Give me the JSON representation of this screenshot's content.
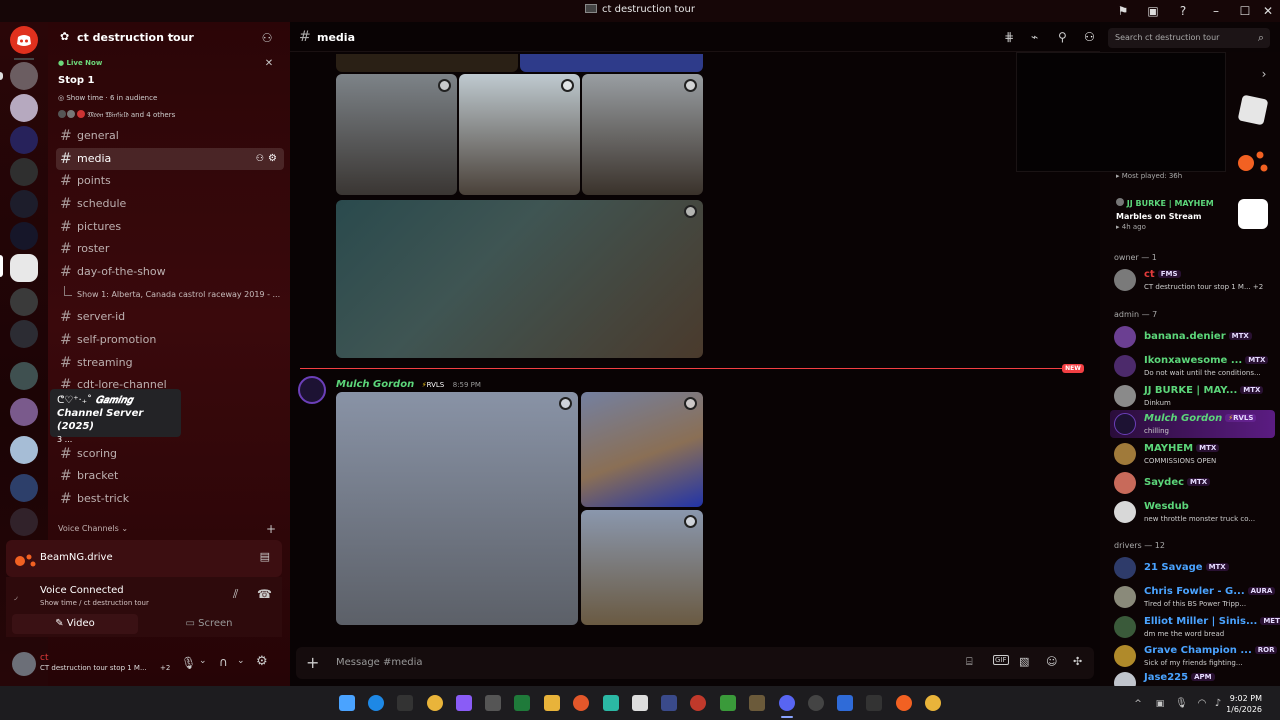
{
  "window": {
    "title": "ct destruction tour"
  },
  "server": {
    "name": "ct destruction tour",
    "live": {
      "badge": "Live Now",
      "title": "Stop 1",
      "meta": "Show time · 6 in audience",
      "participants": "𝔐𝔬𝔬𝔫 𝔚𝔦𝔫𝔣𝔦𝔢𝔩𝔡  and 4 others"
    },
    "channels": [
      {
        "name": "general"
      },
      {
        "name": "media"
      },
      {
        "name": "points"
      },
      {
        "name": "schedule"
      },
      {
        "name": "pictures"
      },
      {
        "name": "roster"
      },
      {
        "name": "day-of-the-show"
      },
      {
        "name": "server-id"
      },
      {
        "name": "self-promotion"
      },
      {
        "name": "streaming"
      },
      {
        "name": "cdt-lore-channel"
      },
      {
        "name": "scoring"
      },
      {
        "name": "bracket"
      },
      {
        "name": "best-trick"
      }
    ],
    "thread": "Show 1: Alberta, Canada castrol raceway 2019 - ...",
    "voice_header": "Voice Channels",
    "tooltip": {
      "line1": "𝑮𝒂𝒎𝒊𝒏𝒈",
      "line2": "Channel Server (2025)",
      "line3": "3 ..."
    }
  },
  "activity": {
    "game": "BeamNG.drive"
  },
  "voice": {
    "status": "Voice Connected",
    "channel": "Show time / ct destruction tour",
    "video_label": "Video",
    "screen_label": "Screen"
  },
  "user": {
    "name": "ct",
    "status": "CT destruction tour stop 1 M...",
    "extra": "+2"
  },
  "chat": {
    "channel": "media",
    "search_placeholder": "Search ct destruction tour",
    "new_badge": "NEW",
    "message": {
      "author": "Mulch Gordon",
      "tag": "RVLS",
      "time": "8:59 PM"
    },
    "composer_placeholder": "Message #media"
  },
  "members": {
    "top_activity": {
      "text": "Most played: 36h",
      "user": "JJ BURKE | MAYHEM",
      "game": "Marbles on Stream",
      "ago": "4h ago"
    },
    "groups": [
      {
        "header": "owner — 1",
        "members": [
          {
            "name": "ct",
            "tag": "FMS",
            "sub": "CT destruction tour stop 1 M... +2",
            "color": "#e23b3b"
          }
        ]
      },
      {
        "header": "admin — 7",
        "members": [
          {
            "name": "banana.denier",
            "tag": "MTX",
            "sub": "",
            "color": "#5cd67a"
          },
          {
            "name": "Ikonxawesome ...",
            "tag": "MTX",
            "sub": "Do not wait until the conditions...",
            "color": "#5cd67a"
          },
          {
            "name": "JJ BURKE | MAY...",
            "tag": "MTX",
            "sub": "Dinkum",
            "color": "#5cd67a"
          },
          {
            "name": "Mulch Gordon",
            "tag": "RVLS",
            "sub": "chilling",
            "color": "#5cd67a"
          },
          {
            "name": "MAYHEM",
            "tag": "MTX",
            "sub": "COMMISSIONS OPEN",
            "color": "#5cd67a"
          },
          {
            "name": "Saydec",
            "tag": "MTX",
            "sub": "",
            "color": "#5cd67a"
          },
          {
            "name": "Wesdub",
            "tag": "",
            "sub": "new throttle monster truck co...",
            "color": "#5cd67a"
          }
        ]
      },
      {
        "header": "drivers — 12",
        "members": [
          {
            "name": "21 Savage",
            "tag": "MTX",
            "sub": "",
            "color": "#4aa3ff"
          },
          {
            "name": "Chris Fowler - G...",
            "tag": "AURA",
            "sub": "Tired of this BS Power Tripp...",
            "color": "#4aa3ff"
          },
          {
            "name": "Elliot Miller | Sinis...",
            "tag": "MET",
            "sub": "dm me the word bread",
            "color": "#4aa3ff"
          },
          {
            "name": "Grave Champion ...",
            "tag": "ROR",
            "sub": "Sick of my friends fighting...",
            "color": "#4aa3ff"
          },
          {
            "name": "Jase225",
            "tag": "APM",
            "sub": "",
            "color": "#4aa3ff"
          }
        ]
      }
    ]
  },
  "taskbar": {
    "time": "9:02 PM",
    "date": "1/6/2026"
  },
  "colors": {
    "accent": "#5865f2",
    "online": "#23a55a",
    "live": "#3ba55d",
    "new": "#f23f43"
  }
}
